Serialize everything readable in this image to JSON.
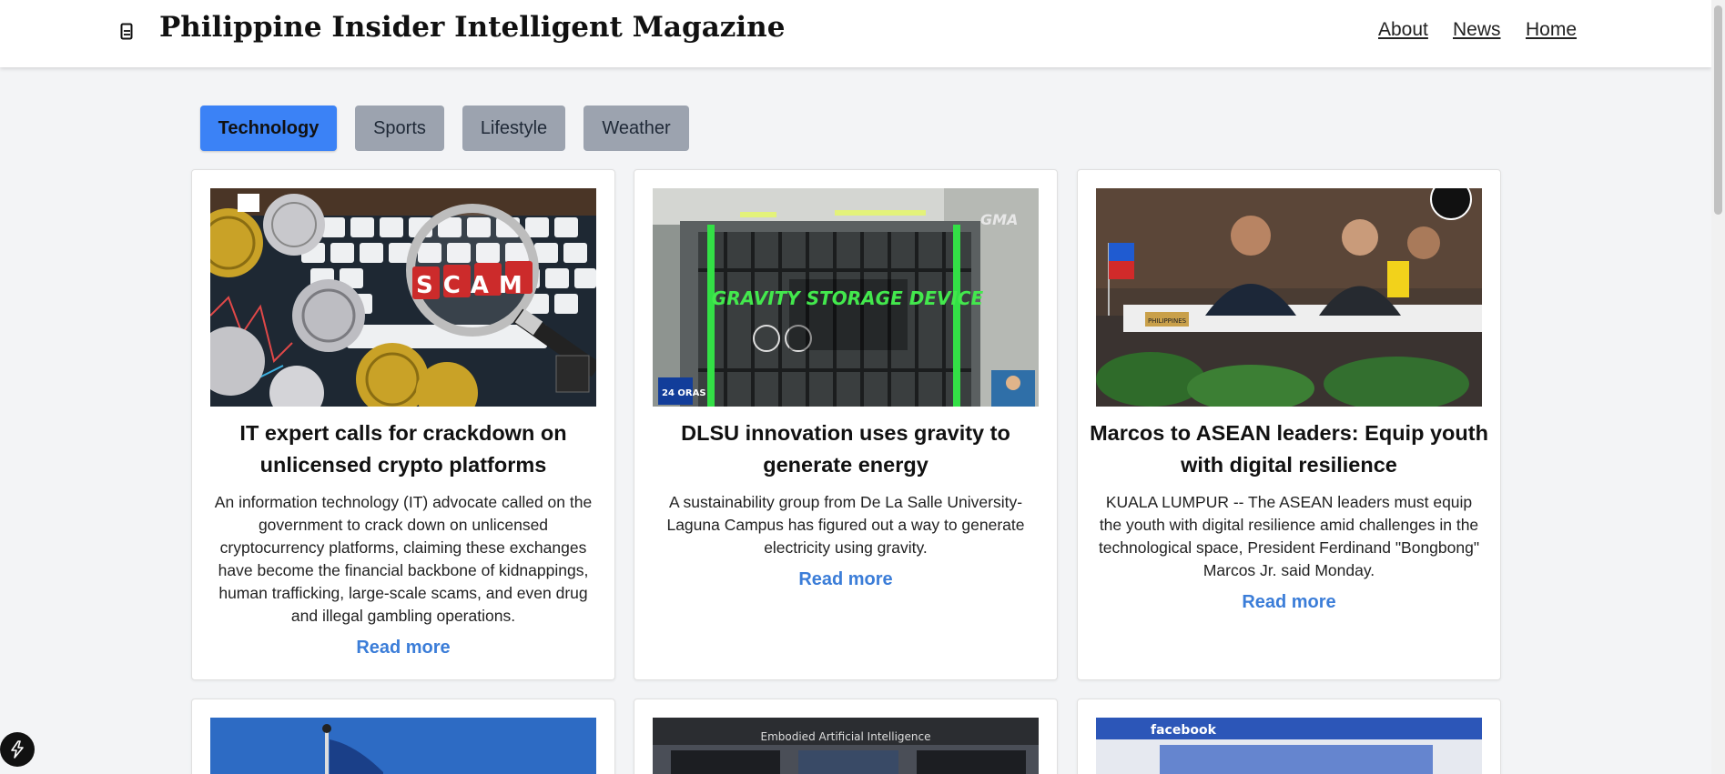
{
  "header": {
    "title": "Philippine Insider Intelligent Magazine",
    "nav": [
      "About",
      "News",
      "Home"
    ]
  },
  "tabs": [
    {
      "label": "Technology",
      "active": true
    },
    {
      "label": "Sports",
      "active": false
    },
    {
      "label": "Lifestyle",
      "active": false
    },
    {
      "label": "Weather",
      "active": false
    }
  ],
  "cards": [
    {
      "title": "IT expert calls for crackdown on unlicensed crypto platforms",
      "description": "An information technology (IT) advocate called on the government to crack down on unlicensed cryptocurrency platforms, claiming these exchanges have become the financial backbone of kidnappings, human trafficking, large-scale scams, and even drug and illegal gambling operations.",
      "link": "Read more",
      "image_text": "SCAM"
    },
    {
      "title": "DLSU innovation uses gravity to generate energy",
      "description": "A sustainability group from De La Salle University-Laguna Campus has figured out a way to generate electricity using gravity.",
      "link": "Read more",
      "image_text": "GRAVITY STORAGE DEVICE",
      "image_badge": "GMA",
      "image_badge2": "24 ORAS"
    },
    {
      "title": "Marcos to ASEAN leaders: Equip youth with digital resilience",
      "description": "KUALA LUMPUR -- The ASEAN leaders must equip the youth with digital resilience amid challenges in the technological space, President Ferdinand \"Bongbong\" Marcos Jr. said Monday.",
      "link": "Read more",
      "image_text": "PHILIPPINES"
    }
  ],
  "second_row_image_text": {
    "middle": "Embodied Artificial Intelligence",
    "right": "facebook"
  },
  "colors": {
    "accent": "#3b82f6",
    "tab_idle": "#9ca3af",
    "link": "#3b7dd8"
  },
  "icons": [
    "book-icon",
    "bolt-icon"
  ]
}
